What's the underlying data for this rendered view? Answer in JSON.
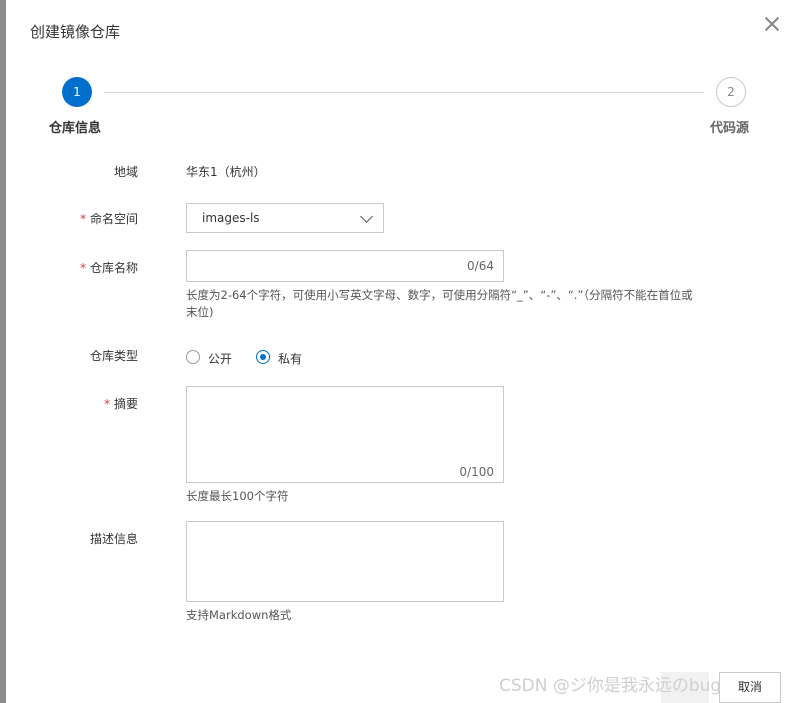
{
  "dialog": {
    "title": "创建镜像仓库"
  },
  "steps": [
    {
      "number": "1",
      "label": "仓库信息"
    },
    {
      "number": "2",
      "label": "代码源"
    }
  ],
  "form": {
    "region": {
      "label": "地域",
      "value": "华东1（杭州）"
    },
    "namespace": {
      "label": "命名空间",
      "value": "images-ls"
    },
    "repo_name": {
      "label": "仓库名称",
      "value": "",
      "counter": "0/64",
      "help_line1": "长度为2-64个字符，可使用小写英文字母、数字，可使用分隔符“_”、“-”、“.”（分隔符不能在首位或",
      "help_line2": "末位)"
    },
    "repo_type": {
      "label": "仓库类型",
      "options": [
        {
          "label": "公开",
          "checked": false
        },
        {
          "label": "私有",
          "checked": true
        }
      ]
    },
    "summary": {
      "label": "摘要",
      "counter": "0/100",
      "help": "长度最长100个字符"
    },
    "description": {
      "label": "描述信息",
      "help": "支持Markdown格式"
    }
  },
  "footer": {
    "cancel_label": "取消"
  },
  "watermark": "CSDN @ジ你是我永远のbug",
  "colors": {
    "primary": "#0070cc",
    "required": "#e4393c",
    "border": "#c9c9c9"
  }
}
